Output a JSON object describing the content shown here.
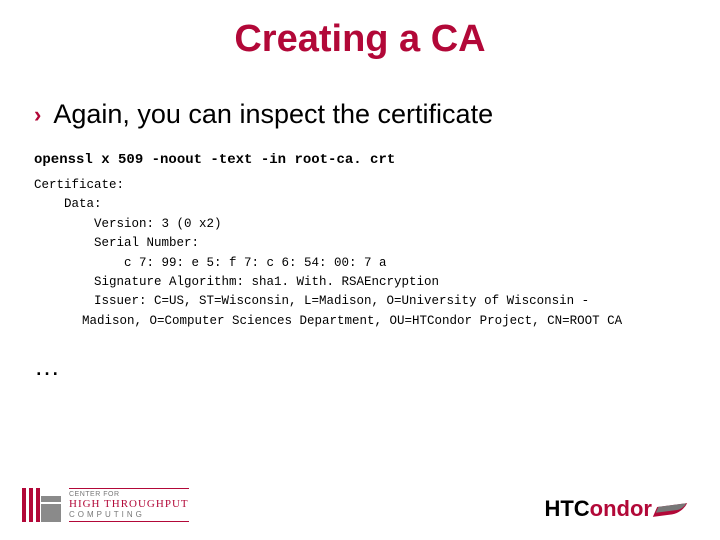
{
  "title": "Creating a CA",
  "bullet": "Again, you can inspect the certificate",
  "command": "openssl x 509 -noout -text -in root-ca. crt",
  "cert": {
    "l1": "Certificate:",
    "l2": "Data:",
    "l3": "Version: 3 (0 x2)",
    "l4": "Serial Number:",
    "l5": "c 7: 99: e 5: f 7: c 6: 54: 00: 7 a",
    "l6": "Signature Algorithm: sha1. With. RSAEncryption",
    "l7": "Issuer: C=US, ST=Wisconsin, L=Madison, O=University of Wisconsin -",
    "l8": "Madison, O=Computer Sciences Department, OU=HTCondor Project, CN=ROOT CA"
  },
  "ellipsis": "…",
  "left_logo": {
    "line1": "CENTER FOR",
    "line2": "HIGH THROUGHPUT",
    "line3": "COMPUTING"
  },
  "right_logo": {
    "part1": "HTC",
    "part2": "ondor"
  }
}
